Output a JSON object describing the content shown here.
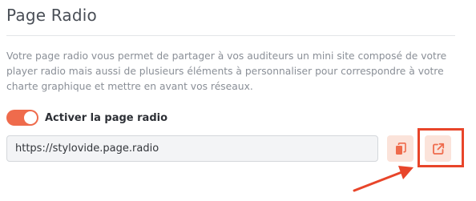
{
  "page": {
    "title": "Page Radio",
    "description": "Votre page radio vous permet de partager à vos auditeurs un mini site composé de votre player radio mais aussi de plusieurs éléments à personnaliser pour correspondre à votre charte graphique et mettre en avant vos réseaux."
  },
  "toggle": {
    "label": "Activer la page radio",
    "enabled": true
  },
  "url_field": {
    "value": "https://stylovide.page.radio"
  },
  "buttons": {
    "copy_icon": "copy-icon",
    "open_icon": "external-link-icon"
  },
  "colors": {
    "accent": "#ef6b4c",
    "button_bg": "#fbe3da",
    "annotation": "#e8452a"
  }
}
